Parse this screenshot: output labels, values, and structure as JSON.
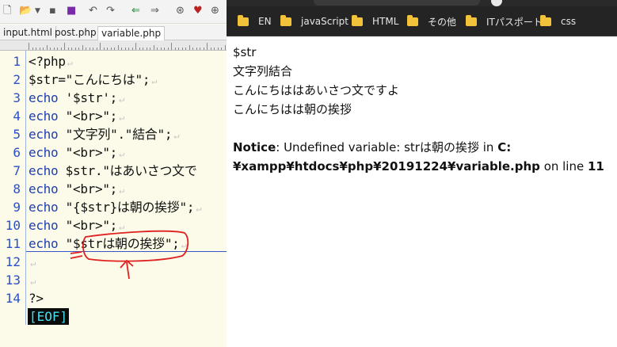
{
  "editor": {
    "tabs": [
      "input.html",
      "post.php",
      "variable.php"
    ],
    "active_tab": "variable.php",
    "eof_label": "[EOF]",
    "eol_mark": "↵",
    "line_numbers": [
      "1",
      "2",
      "3",
      "4",
      "5",
      "6",
      "7",
      "8",
      "9",
      "10",
      "11",
      "12",
      "13",
      "14"
    ],
    "lines": [
      {
        "kw": "",
        "text": "<?php"
      },
      {
        "kw": "",
        "text": "$str=\"こんにちは\";"
      },
      {
        "kw": "echo",
        "text": " '$str';"
      },
      {
        "kw": "echo",
        "text": " \"<br>\";"
      },
      {
        "kw": "echo",
        "text": " \"文字列\".\"結合\";"
      },
      {
        "kw": "echo",
        "text": " \"<br>\";"
      },
      {
        "kw": "echo",
        "text": " $str.\"はあいさつ文で"
      },
      {
        "kw": "echo",
        "text": " \"<br>\";"
      },
      {
        "kw": "echo",
        "text": " \"{$str}は朝の挨拶\";"
      },
      {
        "kw": "echo",
        "text": " \"<br>\";"
      },
      {
        "kw": "echo",
        "text": " \"$strは朝の挨拶\";"
      },
      {
        "kw": "",
        "text": ""
      },
      {
        "kw": "",
        "text": ""
      },
      {
        "kw": "",
        "text": "?>"
      }
    ]
  },
  "browser": {
    "bookmarks": [
      "EN",
      "javaScript",
      "HTML",
      "その他",
      "ITパスポート",
      "css"
    ],
    "output_lines": [
      "$str",
      "文字列結合",
      "こんにちははあいさつ文ですよ",
      "こんにちはは朝の挨拶"
    ],
    "notice": {
      "label": "Notice",
      "message": ": Undefined variable: strは朝の挨拶 in ",
      "path": "C:¥xampp¥htdocs¥php¥20191224¥variable.php",
      "on_line_text": " on line ",
      "line_number": "11"
    }
  },
  "colors": {
    "keyword": "#1f3fb0",
    "line_number": "#2a50c8",
    "annotation": "#e02020",
    "eof_text": "#44e0f0",
    "folder": "#f2c33a"
  }
}
